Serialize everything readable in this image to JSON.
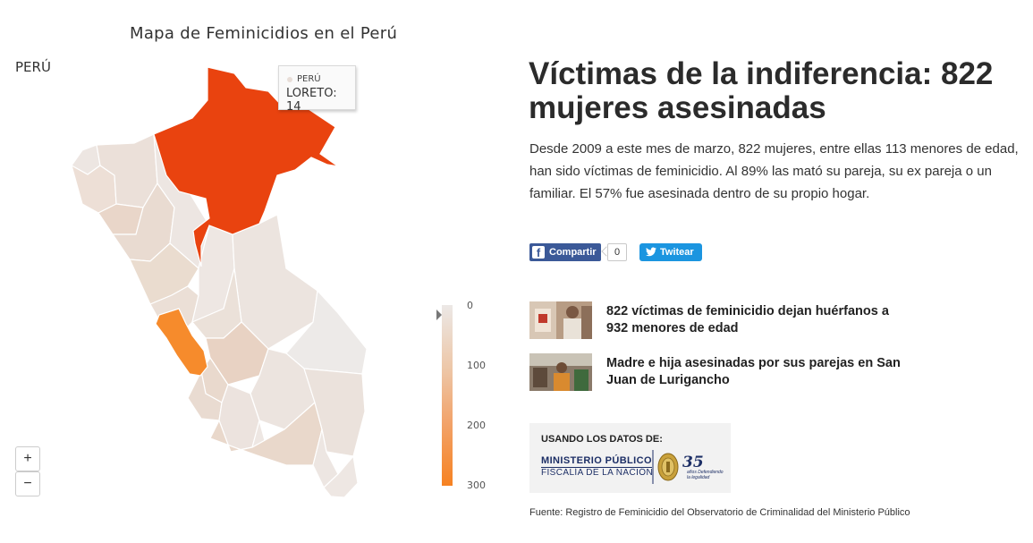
{
  "map": {
    "title": "Mapa de Feminicidios en el Perú",
    "region_label": "PERÚ",
    "tooltip": {
      "region": "PERÚ",
      "value": "LORETO: 14"
    },
    "legend": {
      "ticks": [
        "0",
        "100",
        "200",
        "300"
      ],
      "min": 0,
      "max": 300,
      "color_low": "#ece8e6",
      "color_high": "#f68222"
    },
    "highlight_colors": {
      "loreto": "#e9430f",
      "lima": "#f68b2c",
      "base": "#ede6e2"
    },
    "zoom_in_label": "+",
    "zoom_out_label": "−"
  },
  "article": {
    "headline": "Víctimas de la indiferencia: 822 mujeres asesinadas",
    "intro": "Desde 2009 a este mes de marzo, 822 mujeres, entre ellas 113 menores de edad, han sido víctimas de feminicidio. Al 89% las mató su pareja, su ex pareja o un familiar. El 57% fue asesinada dentro de su propio hogar."
  },
  "share": {
    "facebook_label": "Compartir",
    "facebook_count": "0",
    "twitter_label": "Twitear"
  },
  "related": [
    {
      "title": "822 víctimas de feminicidio dejan huérfanos a 932 menores de edad"
    },
    {
      "title": "Madre e hija asesinadas por sus parejas en San Juan de Lurigancho"
    }
  ],
  "source_box": {
    "label": "USANDO LOS DATOS DE:",
    "org_line1": "MINISTERIO PÚBLICO",
    "org_line2": "FISCALÍA DE LA NACIÓN",
    "anniversary": "35",
    "anniversary_sub": "años Defendiendo la legalidad"
  },
  "footnote": "Fuente: Registro de Feminicidio del Observatorio de Criminalidad del Ministerio Público"
}
